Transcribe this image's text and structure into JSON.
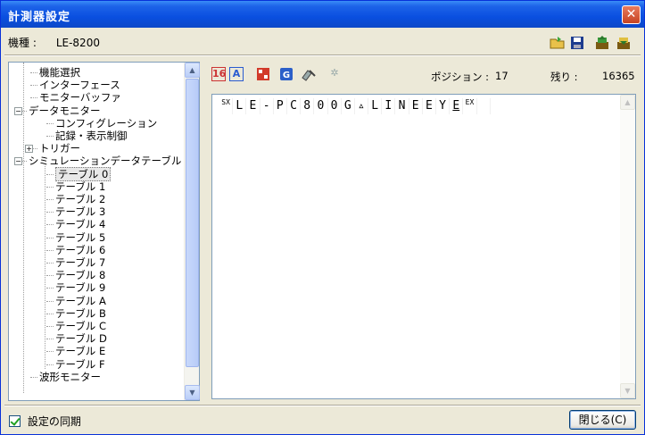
{
  "window": {
    "title": "計測器設定",
    "close_glyph": "✕"
  },
  "model": {
    "label": "機種 :",
    "value": "LE-8200"
  },
  "top_tools": [
    {
      "name": "open-folder-icon",
      "glyph": "📂"
    },
    {
      "name": "save-icon",
      "glyph": "💾"
    },
    {
      "name": "export-icon",
      "glyph": "⇪"
    },
    {
      "name": "import-icon",
      "glyph": "⇩"
    }
  ],
  "tree": {
    "items": [
      {
        "label": "機能選択",
        "level": 1
      },
      {
        "label": "インターフェース",
        "level": 1
      },
      {
        "label": "モニターバッファ",
        "level": 1
      },
      {
        "label": "データモニター",
        "level": 0,
        "expander": "−"
      },
      {
        "label": "コンフィグレーション",
        "level": 2
      },
      {
        "label": "記録・表示制御",
        "level": 2
      },
      {
        "label": "トリガー",
        "level": 1,
        "expander": "+"
      },
      {
        "label": "シミュレーションデータテーブル",
        "level": 0,
        "expander": "−"
      },
      {
        "label": "テーブル 0",
        "level": 2,
        "selected": true
      },
      {
        "label": "テーブル 1",
        "level": 2
      },
      {
        "label": "テーブル 2",
        "level": 2
      },
      {
        "label": "テーブル 3",
        "level": 2
      },
      {
        "label": "テーブル 4",
        "level": 2
      },
      {
        "label": "テーブル 5",
        "level": 2
      },
      {
        "label": "テーブル 6",
        "level": 2
      },
      {
        "label": "テーブル 7",
        "level": 2
      },
      {
        "label": "テーブル 8",
        "level": 2
      },
      {
        "label": "テーブル 9",
        "level": 2
      },
      {
        "label": "テーブル A",
        "level": 2
      },
      {
        "label": "テーブル B",
        "level": 2
      },
      {
        "label": "テーブル C",
        "level": 2
      },
      {
        "label": "テーブル D",
        "level": 2
      },
      {
        "label": "テーブル E",
        "level": 2
      },
      {
        "label": "テーブル F",
        "level": 2
      },
      {
        "label": "波形モニター",
        "level": 1
      }
    ]
  },
  "editor_tools": {
    "hex_label": "16",
    "ascii_label": "A",
    "position_label": "ポジション :",
    "position_value": "17",
    "remaining_label": "残り :",
    "remaining_value": "16365"
  },
  "editor": {
    "cells": [
      {
        "t": "SX",
        "ctl": true
      },
      {
        "t": "L"
      },
      {
        "t": "E"
      },
      {
        "t": "-"
      },
      {
        "t": "P"
      },
      {
        "t": "C"
      },
      {
        "t": "8"
      },
      {
        "t": "0"
      },
      {
        "t": "0"
      },
      {
        "t": "G"
      },
      {
        "t": "▵",
        "ctl": false
      },
      {
        "t": "L"
      },
      {
        "t": "I"
      },
      {
        "t": "N"
      },
      {
        "t": "E"
      },
      {
        "t": "E"
      },
      {
        "t": "Y"
      },
      {
        "t": "E",
        "under": true
      },
      {
        "t": "EX",
        "ctl": true
      },
      {
        "t": ""
      }
    ]
  },
  "footer": {
    "sync_label": "設定の同期",
    "sync_checked": true,
    "close_label": "閉じる(C)"
  }
}
